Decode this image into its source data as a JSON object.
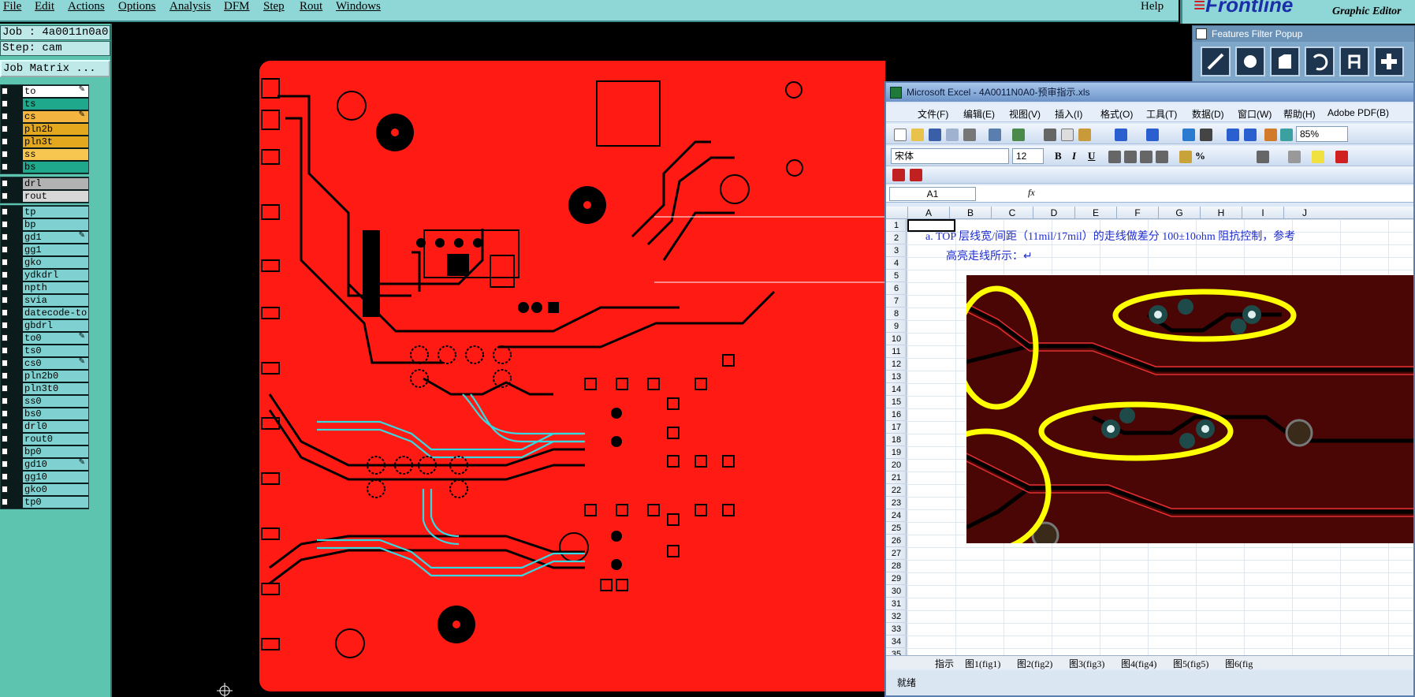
{
  "menubar": {
    "items": [
      "File",
      "Edit",
      "Actions",
      "Options",
      "Analysis",
      "DFM",
      "Step",
      "Rout",
      "Windows"
    ],
    "help": "Help"
  },
  "brand": {
    "logo": "Frontline",
    "subtitle": "Graphic Editor"
  },
  "left_panel": {
    "job": "Job : 4a0011n0a0",
    "step": "Step: cam",
    "matrix_button": "Job Matrix ...",
    "groups": [
      [
        {
          "name": "to",
          "color": "#ffffff",
          "edit": true
        },
        {
          "name": "ts",
          "color": "#1fa88c"
        },
        {
          "name": "cs",
          "color": "#f3b540",
          "edit": true
        },
        {
          "name": "pln2b",
          "color": "#e4a81f"
        },
        {
          "name": "pln3t",
          "color": "#e4a81f"
        },
        {
          "name": "ss",
          "color": "#f7c650"
        },
        {
          "name": "bs",
          "color": "#1fa88c"
        }
      ],
      [
        {
          "name": "drl",
          "color": "#b2b2b2"
        },
        {
          "name": "rout",
          "color": "#d8d8d8"
        }
      ],
      [
        {
          "name": "tp",
          "color": "#7fd0d0"
        },
        {
          "name": "bp",
          "color": "#7fd0d0"
        },
        {
          "name": "gd1",
          "color": "#7fd0d0",
          "edit": true
        },
        {
          "name": "gg1",
          "color": "#7fd0d0"
        },
        {
          "name": "gko",
          "color": "#7fd0d0"
        },
        {
          "name": "ydkdrl",
          "color": "#7fd0d0"
        },
        {
          "name": "npth",
          "color": "#7fd0d0"
        },
        {
          "name": "svia",
          "color": "#7fd0d0"
        },
        {
          "name": "datecode-to",
          "color": "#7fd0d0"
        },
        {
          "name": "gbdrl",
          "color": "#7fd0d0"
        },
        {
          "name": "to0",
          "color": "#7fd0d0",
          "edit": true
        },
        {
          "name": "ts0",
          "color": "#7fd0d0"
        },
        {
          "name": "cs0",
          "color": "#7fd0d0",
          "edit": true
        },
        {
          "name": "pln2b0",
          "color": "#7fd0d0"
        },
        {
          "name": "pln3t0",
          "color": "#7fd0d0"
        },
        {
          "name": "ss0",
          "color": "#7fd0d0"
        },
        {
          "name": "bs0",
          "color": "#7fd0d0"
        },
        {
          "name": "drl0",
          "color": "#7fd0d0"
        },
        {
          "name": "rout0",
          "color": "#7fd0d0"
        },
        {
          "name": "bp0",
          "color": "#7fd0d0"
        },
        {
          "name": "gd10",
          "color": "#7fd0d0",
          "edit": true
        },
        {
          "name": "gg10",
          "color": "#7fd0d0"
        },
        {
          "name": "gko0",
          "color": "#7fd0d0"
        },
        {
          "name": "tp0",
          "color": "#7fd0d0"
        }
      ]
    ]
  },
  "features_popup": {
    "title": "Features Filter Popup",
    "tools": [
      "line-icon",
      "pad-icon",
      "surface-icon",
      "arc-icon",
      "text-icon",
      "plus-icon"
    ]
  },
  "excel": {
    "title": "Microsoft Excel - 4A0011N0A0-预审指示.xls",
    "menu": [
      "文件(F)",
      "编辑(E)",
      "视图(V)",
      "插入(I)",
      "格式(O)",
      "工具(T)",
      "数据(D)",
      "窗口(W)",
      "帮助(H)",
      "Adobe PDF(B)"
    ],
    "zoom": "85%",
    "font_name": "宋体",
    "font_size": "12",
    "name_box": "A1",
    "fx": "fx",
    "columns": [
      "A",
      "B",
      "C",
      "D",
      "E",
      "F",
      "G",
      "H",
      "I",
      "J"
    ],
    "rows": [
      "1",
      "2",
      "3",
      "4",
      "5",
      "6",
      "7",
      "8",
      "9",
      "10",
      "11",
      "12",
      "13",
      "14",
      "15",
      "16",
      "17",
      "18",
      "19",
      "20",
      "21",
      "22",
      "23",
      "24",
      "25",
      "26",
      "27",
      "28",
      "29",
      "30",
      "31",
      "32",
      "33",
      "34",
      "35"
    ],
    "note_line1": "a.   TOP 层线宽/间距（11mil/17mil）的走线做差分 100±10ohm 阻抗控制，参考",
    "note_line2": "高亮走线所示：↵",
    "sheet_tabs": [
      "指示",
      "图1(fig1)",
      "图2(fig2)",
      "图3(fig3)",
      "图4(fig4)",
      "图5(fig5)",
      "图6(fig"
    ],
    "status": "就绪"
  }
}
